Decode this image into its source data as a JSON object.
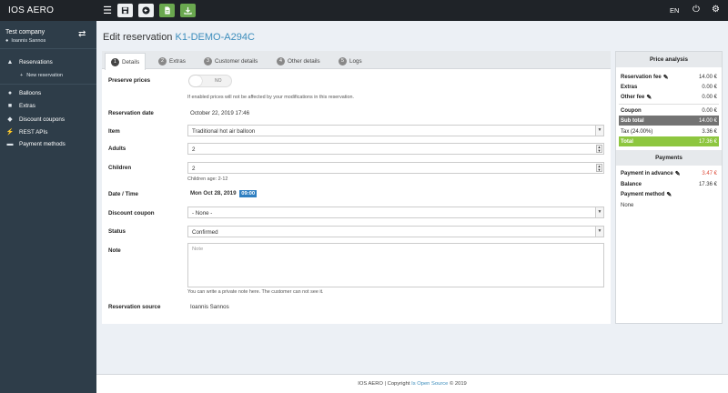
{
  "app": {
    "title": "IOS AERO"
  },
  "topbar": {
    "language": "EN"
  },
  "sidebar": {
    "company": "Test company",
    "user": "Ioannis Sannos",
    "items": [
      {
        "label": "Reservations",
        "icon": "plane-icon"
      },
      {
        "label": "Balloons",
        "icon": "balloon-icon"
      },
      {
        "label": "Extras",
        "icon": "box-icon"
      },
      {
        "label": "Discount coupons",
        "icon": "tag-icon"
      },
      {
        "label": "REST APIs",
        "icon": "plug-icon"
      },
      {
        "label": "Payment methods",
        "icon": "card-icon"
      }
    ],
    "new_reservation": "New reservation"
  },
  "page": {
    "title": "Edit reservation",
    "code": "K1-DEMO-A294C"
  },
  "tabs": [
    {
      "num": "1",
      "label": "Details"
    },
    {
      "num": "2",
      "label": "Extras"
    },
    {
      "num": "3",
      "label": "Customer details"
    },
    {
      "num": "4",
      "label": "Other details"
    },
    {
      "num": "5",
      "label": "Logs"
    }
  ],
  "form": {
    "preserve_prices": {
      "label": "Preserve prices",
      "toggle": "NO",
      "hint": "If enabled prices will not be affected by your modifications in this reservation."
    },
    "reservation_date": {
      "label": "Reservation date",
      "value": "October 22, 2019 17:46"
    },
    "item": {
      "label": "Item",
      "value": "Traditional hot air balloon"
    },
    "adults": {
      "label": "Adults",
      "value": "2"
    },
    "children": {
      "label": "Children",
      "value": "2",
      "hint": "Children age: 2-12"
    },
    "datetime": {
      "label": "Date / Time",
      "date": "Mon Oct 28, 2019",
      "time": "09:00"
    },
    "discount_coupon": {
      "label": "Discount coupon",
      "value": "- None -"
    },
    "status": {
      "label": "Status",
      "value": "Confirmed"
    },
    "note": {
      "label": "Note",
      "placeholder": "Note",
      "hint": "You can write a private note here. The customer can not see it."
    },
    "source": {
      "label": "Reservation source",
      "value": "Ioannis Sannos"
    }
  },
  "price_analysis": {
    "title": "Price analysis",
    "rows": [
      {
        "key": "Reservation fee",
        "value": "14.00 €"
      },
      {
        "key": "Extras",
        "value": "0.00 €"
      },
      {
        "key": "Other fee",
        "value": "0.00 €"
      },
      {
        "key": "Coupon",
        "value": "0.00 €"
      },
      {
        "key": "Sub total",
        "value": "14.00 €"
      },
      {
        "key": "Tax (24.00%)",
        "value": "3.36 €"
      },
      {
        "key": "Total",
        "value": "17.36 €"
      }
    ]
  },
  "payments": {
    "title": "Payments",
    "payment_in_advance": {
      "key": "Payment in advance",
      "value": "3.47 €"
    },
    "balance": {
      "key": "Balance",
      "value": "17.36 €"
    },
    "payment_method": {
      "key": "Payment method",
      "value": "None"
    }
  },
  "footer": {
    "prefix": "IOS AERO | Copyright",
    "link": "Is Open Source",
    "suffix": "© 2019"
  },
  "colors": {
    "accent": "#3c8dbc",
    "sidebar": "#2e3d49",
    "total": "#8dc63f",
    "subtotal": "#737373",
    "topbar": "#1f2328"
  }
}
